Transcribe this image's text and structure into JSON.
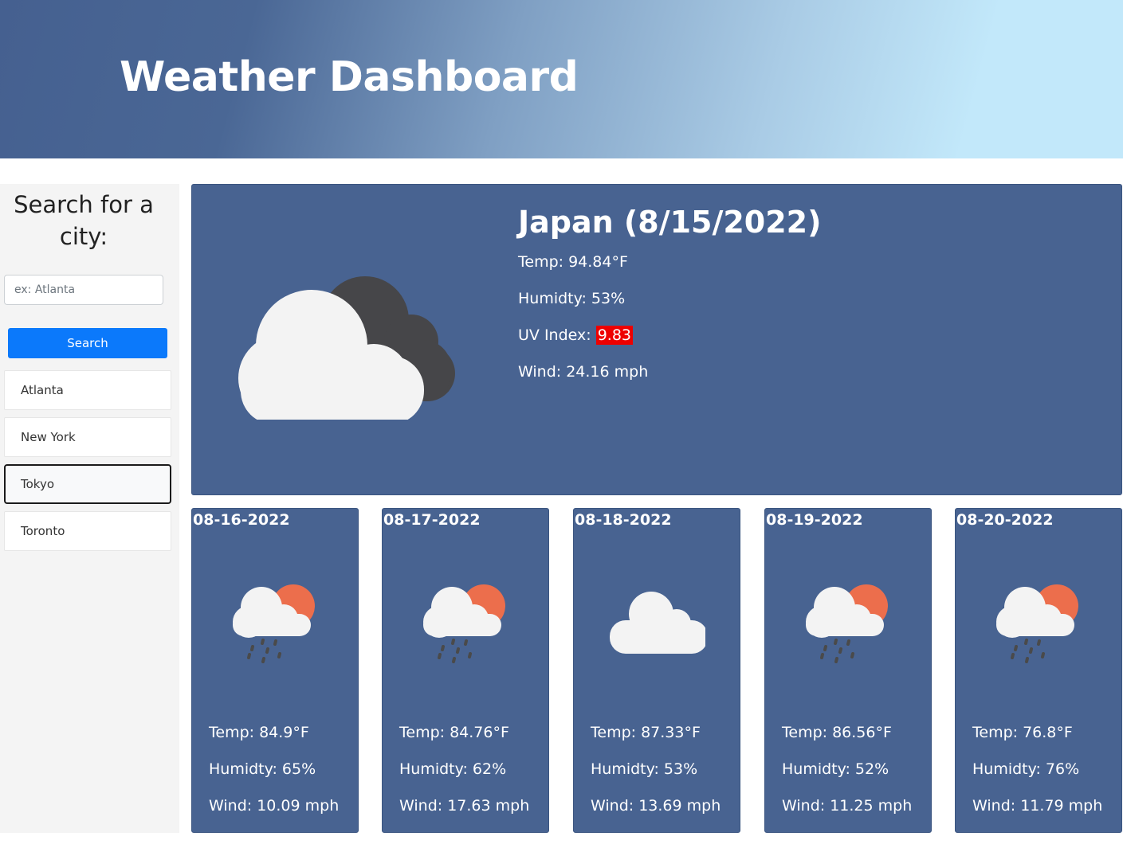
{
  "header": {
    "title": "Weather Dashboard"
  },
  "sidebar": {
    "title": "Search for a city:",
    "search_placeholder": "ex: Atlanta",
    "search_label": "Search",
    "cities": [
      "Atlanta",
      "New York",
      "Tokyo",
      "Toronto"
    ],
    "active_city": "Tokyo"
  },
  "current": {
    "title": "Japan (8/15/2022)",
    "icon": "cloudy-icon",
    "temp": "Temp: 94.84°F",
    "humidity": "Humidty: 53%",
    "uv_label": "UV Index: ",
    "uv_value": "9.83",
    "uv_color": "#ee0000",
    "wind": "Wind: 24.16 mph"
  },
  "forecast": [
    {
      "date": "08-16-2022",
      "icon": "rain-sun-icon",
      "temp": "Temp: 84.9°F",
      "humidity": "Humidty: 65%",
      "wind": "Wind: 10.09 mph"
    },
    {
      "date": "08-17-2022",
      "icon": "rain-sun-icon",
      "temp": "Temp: 84.76°F",
      "humidity": "Humidty: 62%",
      "wind": "Wind: 17.63 mph"
    },
    {
      "date": "08-18-2022",
      "icon": "cloud-icon",
      "temp": "Temp: 87.33°F",
      "humidity": "Humidty: 53%",
      "wind": "Wind: 13.69 mph"
    },
    {
      "date": "08-19-2022",
      "icon": "rain-sun-icon",
      "temp": "Temp: 86.56°F",
      "humidity": "Humidty: 52%",
      "wind": "Wind: 11.25 mph"
    },
    {
      "date": "08-20-2022",
      "icon": "rain-sun-icon",
      "temp": "Temp: 76.8°F",
      "humidity": "Humidty: 76%",
      "wind": "Wind: 11.79 mph"
    }
  ],
  "colors": {
    "panel": "#486391",
    "button": "#0b79fb",
    "sun": "#ec6e4c",
    "cloud_dark": "#464649",
    "cloud_light": "#f3f3f3"
  }
}
